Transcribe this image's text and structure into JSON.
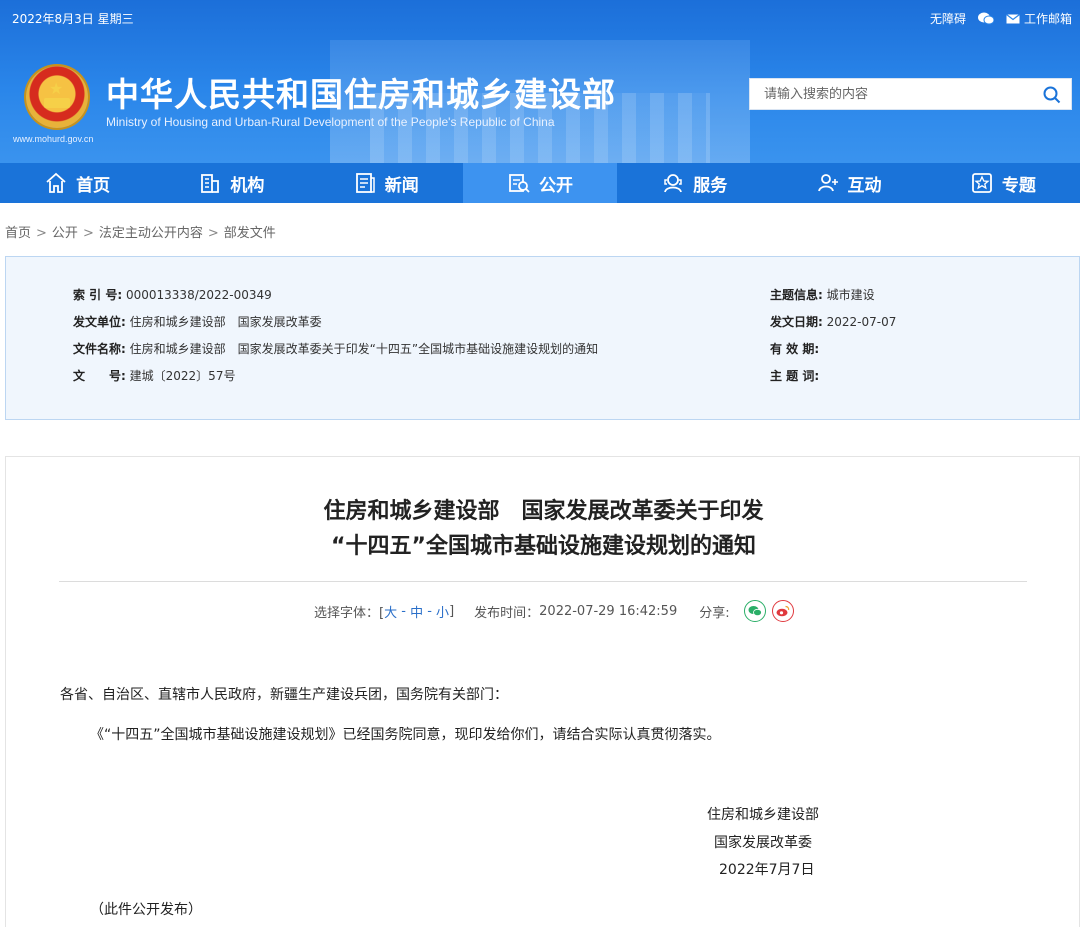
{
  "topbar": {
    "date": "2022年8月3日 星期三",
    "accessibility": "无障碍",
    "mail": "工作邮箱"
  },
  "header": {
    "title": "中华人民共和国住房和城乡建设部",
    "subtitle": "Ministry of Housing and Urban-Rural Development of the People's Republic of China",
    "url": "www.mohurd.gov.cn"
  },
  "search": {
    "placeholder": "请输入搜索的内容"
  },
  "nav": {
    "items": [
      {
        "label": "首页",
        "icon": "home-icon"
      },
      {
        "label": "机构",
        "icon": "building-icon"
      },
      {
        "label": "新闻",
        "icon": "news-icon"
      },
      {
        "label": "公开",
        "icon": "open-icon"
      },
      {
        "label": "服务",
        "icon": "service-icon"
      },
      {
        "label": "互动",
        "icon": "interact-icon"
      },
      {
        "label": "专题",
        "icon": "topic-icon"
      }
    ],
    "active": "公开"
  },
  "breadcrumb": [
    "首页",
    "公开",
    "法定主动公开内容",
    "部发文件"
  ],
  "meta": {
    "index_label": "索 引 号:",
    "index_value": "000013338/2022-00349",
    "issuer_label": "发文单位:",
    "issuer_value": "住房和城乡建设部　国家发展改革委",
    "name_label": "文件名称:",
    "name_value": "住房和城乡建设部　国家发展改革委关于印发“十四五”全国城市基础设施建设规划的通知",
    "doc_label": "文　　号:",
    "doc_value": "建城〔2022〕57号",
    "topic_label": "主题信息:",
    "topic_value": "城市建设",
    "date_label": "发文日期:",
    "date_value": "2022-07-07",
    "valid_label": "有 效 期:",
    "valid_value": "",
    "keywords_label": "主 题 词:",
    "keywords_value": ""
  },
  "article": {
    "title_line1": "住房和城乡建设部　国家发展改革委关于印发",
    "title_line2": "“十四五”全国城市基础设施建设规划的通知",
    "font_label": "选择字体：[",
    "font_large": "大",
    "font_medium": "中",
    "font_small": "小",
    "font_close": "]",
    "publish_label": "发布时间：",
    "publish_time": "2022-07-29 16:42:59",
    "share_label": "分享:",
    "salutation": "各省、自治区、直辖市人民政府，新疆生产建设兵团，国务院有关部门：",
    "paragraph": "《“十四五”全国城市基础设施建设规划》已经国务院同意，现印发给你们，请结合实际认真贯彻落实。",
    "sign1": "住房和城乡建设部",
    "sign2": "国家发展改革委",
    "sign_date": "2022年7月7日",
    "note": "（此件公开发布）"
  },
  "colors": {
    "header_blue": "#1c6fd9",
    "nav_blue": "#1a73d9",
    "nav_active": "#3d93f0",
    "meta_bg": "#f0f6fd",
    "link_blue": "#2a6fc9",
    "wechat_green": "#2aae67",
    "weibo_red": "#e0393e"
  }
}
